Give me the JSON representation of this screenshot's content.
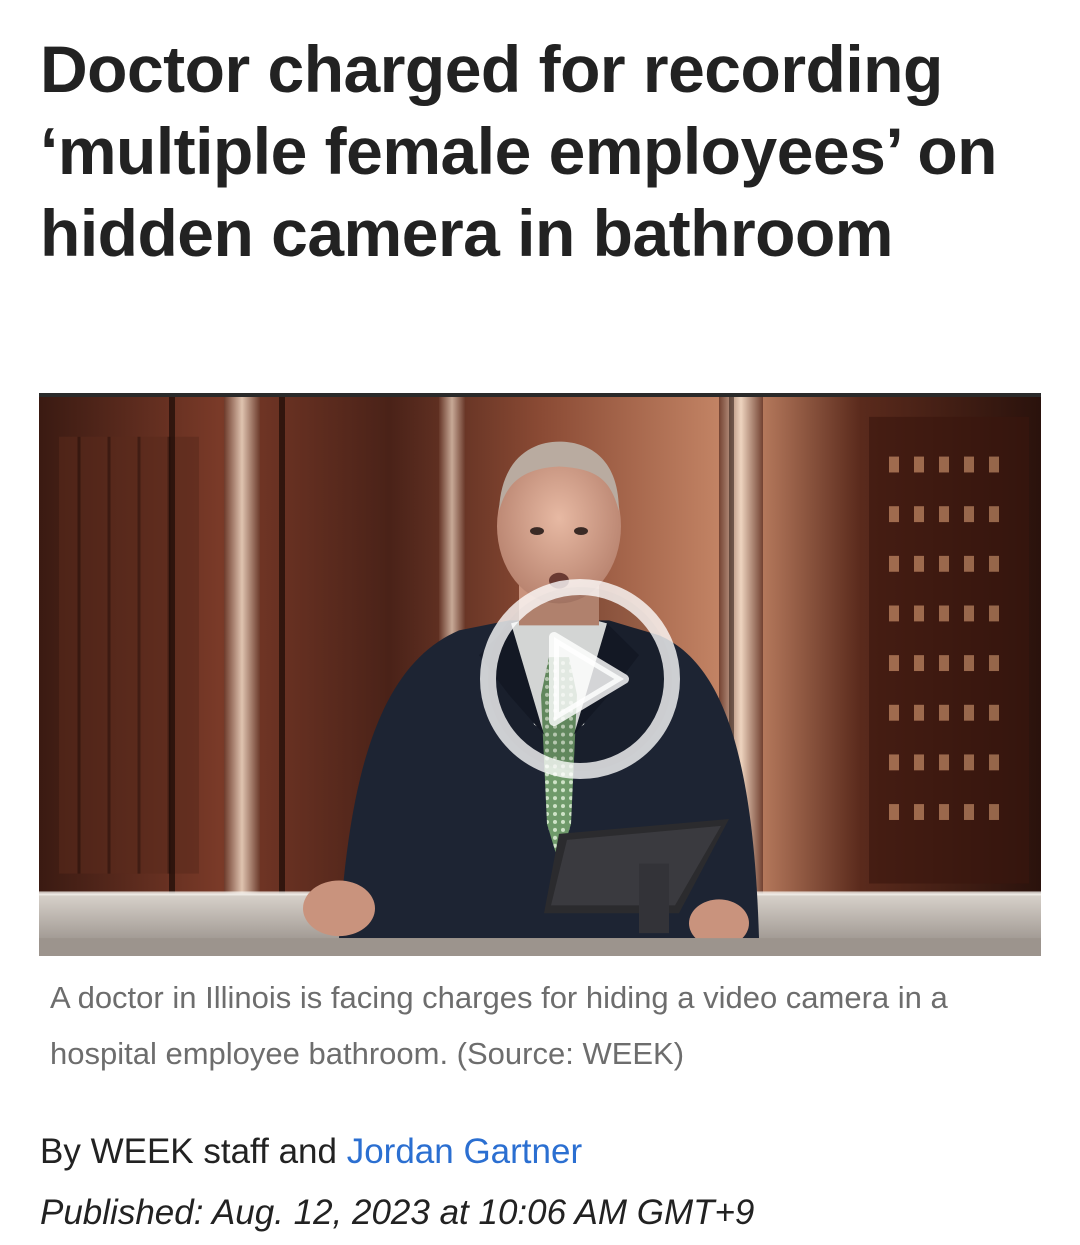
{
  "article": {
    "headline": "Doctor charged for recording ‘multiple female employees’ on hidden camera in bathroom",
    "video": {
      "play_icon": "play-circle-icon"
    },
    "caption": "A doctor in Illinois is facing charges for hiding a video camera in a hospital employee bathroom. (Source: WEEK)",
    "byline": {
      "prefix": "By WEEK staff and ",
      "author_link": "Jordan Gartner"
    },
    "published": {
      "label": "Published:",
      "datetime": "Aug. 12, 2023 at 10:06 AM GMT+9"
    }
  },
  "colors": {
    "headline": "#222222",
    "caption": "#6d6d6d",
    "link": "#2b6fd1"
  }
}
